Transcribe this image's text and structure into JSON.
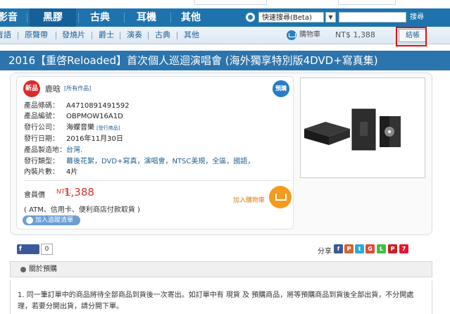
{
  "top_strip": {
    "left_text": "",
    "right_text": ""
  },
  "nav": {
    "tabs": [
      "影音",
      "黑膠",
      "古典",
      "耳機",
      "其他"
    ],
    "search_mode": "快速搜尋(Beta)",
    "search_value": "",
    "search_button": "搜尋"
  },
  "subnav": {
    "items": [
      "音語",
      "原聲帶",
      "發燒片",
      "爵士",
      "演奏",
      "古典",
      "其他"
    ],
    "cart_label": "購物車",
    "cart_total": "NT$ 1,388",
    "checkout": "結帳"
  },
  "product": {
    "title": "2016【重啓Reloaded】首次個人巡迴演唱會 (海外獨享特別版4DVD+寫真集)",
    "new_badge": "新品",
    "preorder_badge": "預購",
    "artist": "鹿晗",
    "all_works": "[所有作品]",
    "rows": [
      {
        "key": "產品條碼：",
        "value": "A4710891491592"
      },
      {
        "key": "產品編號：",
        "value": "OBPMOW16A1D"
      },
      {
        "key": "發行公司：",
        "value": "海蝶音樂",
        "extra": "[發行商品]"
      },
      {
        "key": "發行日期：",
        "value": "2016年11月30日"
      },
      {
        "key": "產品製造地：",
        "value": "台灣."
      },
      {
        "key": "發行類型：",
        "value": "幕後花絮，DVD+寫真，演唱會，NTSC美規，全區，國語，"
      },
      {
        "key": "內裝片數：",
        "value": "4片"
      }
    ],
    "member_price_label": "會員價",
    "currency": "NT$:",
    "member_price": "1,388",
    "payment_note": "( ATM、信用卡、便利商店付款取貨 )",
    "add_to_cart": "加入購物車",
    "add_to_tracking": "加入追蹤清單"
  },
  "share": {
    "fb_label": "f 讚",
    "fb_count": "0",
    "label": "分享",
    "icons": [
      {
        "name": "facebook-share-icon",
        "glyph": "f",
        "color": "#3b5998"
      },
      {
        "name": "plurk-share-icon",
        "glyph": "P",
        "color": "#cf682f"
      },
      {
        "name": "twitter-share-icon",
        "glyph": "t",
        "color": "#2aa9e0"
      },
      {
        "name": "google-share-icon",
        "glyph": "G",
        "color": "#dd4b39"
      },
      {
        "name": "line-share-icon",
        "glyph": "L",
        "color": "#3fbf3f"
      },
      {
        "name": "pinterest-share-icon",
        "glyph": "P",
        "color": "#cb2027"
      },
      {
        "name": "weibo-share-icon",
        "glyph": "7",
        "color": "#e6162d"
      }
    ]
  },
  "preorder_section": {
    "title": "關於預購",
    "note": "1. 同一筆訂單中的商品將待全部商品到貨後一次寄出。如訂單中有 現貨 及 預購商品，將等預購商品到貨後全部出貨，不分開處理，若要分開出貨，請分開下單。"
  }
}
